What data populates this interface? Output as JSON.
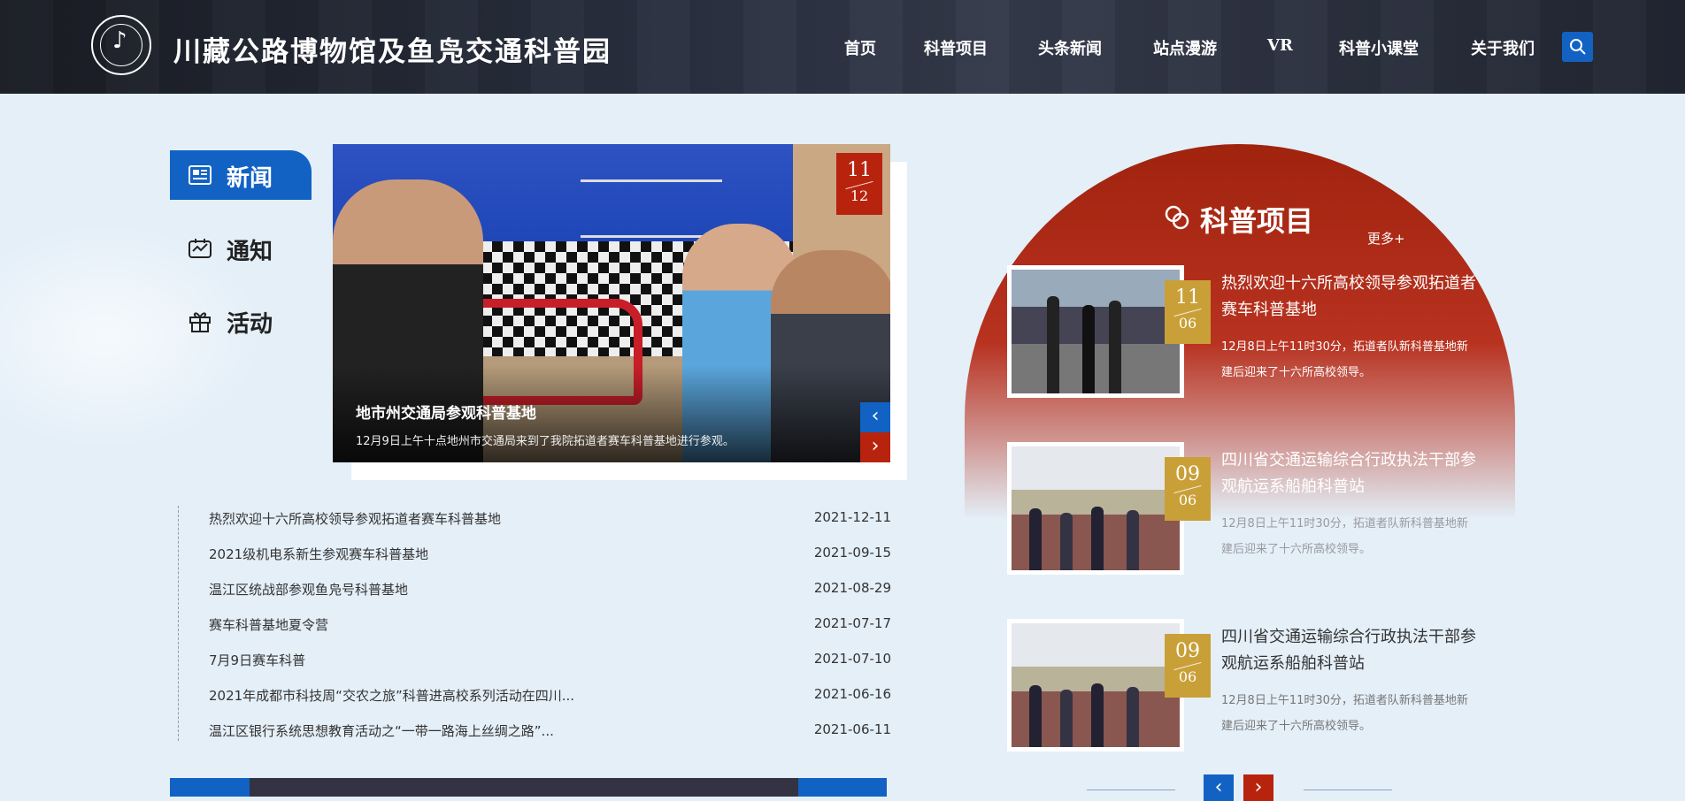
{
  "header": {
    "site_title": "川藏公路博物馆及鱼凫交通科普园",
    "nav": [
      "首页",
      "科普项目",
      "头条新闻",
      "站点漫游",
      "VR",
      "科普小课堂",
      "关于我们"
    ]
  },
  "tabs": [
    {
      "label": "新闻",
      "icon": "newspaper-icon",
      "active": true
    },
    {
      "label": "通知",
      "icon": "notice-icon",
      "active": false
    },
    {
      "label": "活动",
      "icon": "gift-icon",
      "active": false
    }
  ],
  "slider": {
    "title": "地市州交通局参观科普基地",
    "desc": "12月9日上午十点地州市交通局来到了我院拓道者赛车科普基地进行参观。",
    "date_month": "11",
    "date_day": "12"
  },
  "news": [
    {
      "title": "热烈欢迎十六所高校领导参观拓道者赛车科普基地",
      "date": "2021-12-11"
    },
    {
      "title": "2021级机电系新生参观赛车科普基地",
      "date": "2021-09-15"
    },
    {
      "title": "温江区统战部参观鱼凫号科普基地",
      "date": "2021-08-29"
    },
    {
      "title": "赛车科普基地夏令营",
      "date": "2021-07-17"
    },
    {
      "title": "7月9日赛车科普",
      "date": "2021-07-10"
    },
    {
      "title": "2021年成都市科技周“交农之旅”科普进高校系列活动在四川...",
      "date": "2021-06-16"
    },
    {
      "title": "温江区银行系统思想教育活动之“一带一路海上丝绸之路”...",
      "date": "2021-06-11"
    }
  ],
  "science": {
    "title": "科普项目",
    "more": "更多+",
    "items": [
      {
        "title": "热烈欢迎十六所高校领导参观拓道者赛车科普基地",
        "desc": "12月8日上午11时30分，拓道者队新科普基地新建后迎来了十六所高校领导。",
        "month": "11",
        "day": "06"
      },
      {
        "title": "四川省交通运输综合行政执法干部参观航运系船舶科普站",
        "desc": "12月8日上午11时30分，拓道者队新科普基地新建后迎来了十六所高校领导。",
        "month": "09",
        "day": "06"
      },
      {
        "title": "四川省交通运输综合行政执法干部参观航运系船舶科普站",
        "desc": "12月8日上午11时30分，拓道者队新科普基地新建后迎来了十六所高校领导。",
        "month": "09",
        "day": "06"
      }
    ]
  },
  "colors": {
    "brand_blue": "#1262c4",
    "brand_red": "#b8230e",
    "gold": "#c9a038"
  }
}
